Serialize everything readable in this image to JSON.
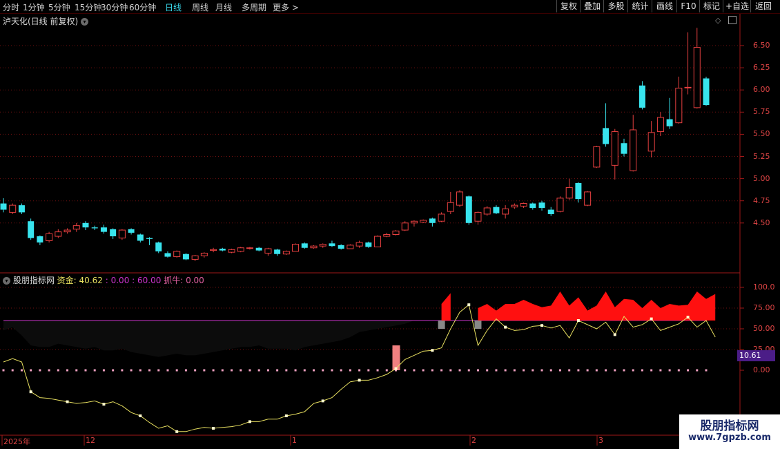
{
  "toolbar": {
    "periods": [
      "分时",
      "1分钟",
      "5分钟",
      "15分钟",
      "30分钟",
      "60分钟",
      "日线",
      "周线",
      "月线",
      "多周期",
      "更多 >"
    ],
    "active_period": "日线",
    "tools": [
      "复权",
      "叠加",
      "多股",
      "统计",
      "画线",
      "F10",
      "标记",
      "+自选",
      "返回"
    ]
  },
  "stock": {
    "title": "泸天化(日线 前复权)"
  },
  "price_axis": {
    "labels": [
      "6.50",
      "6.25",
      "6.00",
      "5.75",
      "5.50",
      "5.25",
      "5.00",
      "4.75",
      "4.50"
    ]
  },
  "indicator": {
    "name": "股朋指标网",
    "fund_label": "资金:",
    "fund_value": "40.62",
    "v2": "0.00",
    "v3": "60.00",
    "grab_label": "抓牛:",
    "grab_value": "0.00",
    "axis_labels": [
      "100.0",
      "75.00",
      "50.00",
      "25.00",
      "0.00"
    ],
    "badge": "10.61"
  },
  "date_axis": {
    "labels": [
      "2025年",
      "12",
      "1",
      "2",
      "3"
    ]
  },
  "watermark": {
    "line1": "股朋指标网",
    "line2": "www.7gpzb.com"
  },
  "colors": {
    "up": "#e84040",
    "down": "#38e4ee",
    "magenta": "#cc33cc",
    "fund": "#e8e060"
  },
  "chart_data": [
    {
      "type": "candlestick",
      "title": "泸天化(日线 前复权)",
      "ylim": [
        4.2,
        6.75
      ],
      "candles": [
        [
          4.72,
          4.65,
          4.78,
          4.62
        ],
        [
          4.62,
          4.7,
          4.72,
          4.6
        ],
        [
          4.7,
          4.62,
          4.72,
          4.6
        ],
        [
          4.52,
          4.33,
          4.55,
          4.31
        ],
        [
          4.35,
          4.28,
          4.36,
          4.25
        ],
        [
          4.3,
          4.38,
          4.4,
          4.28
        ],
        [
          4.35,
          4.4,
          4.43,
          4.33
        ],
        [
          4.4,
          4.42,
          4.44,
          4.38
        ],
        [
          4.43,
          4.47,
          4.5,
          4.4
        ],
        [
          4.5,
          4.45,
          4.52,
          4.42
        ],
        [
          4.45,
          4.44,
          4.47,
          4.42
        ],
        [
          4.45,
          4.4,
          4.48,
          4.38
        ],
        [
          4.43,
          4.35,
          4.44,
          4.32
        ],
        [
          4.33,
          4.42,
          4.43,
          4.31
        ],
        [
          4.43,
          4.39,
          4.44,
          4.37
        ],
        [
          4.37,
          4.3,
          4.38,
          4.28
        ],
        [
          4.33,
          4.32,
          4.34,
          4.25
        ],
        [
          4.28,
          4.18,
          4.29,
          4.16
        ],
        [
          4.16,
          4.12,
          4.18,
          4.11
        ],
        [
          4.12,
          4.18,
          4.19,
          4.11
        ],
        [
          4.15,
          4.09,
          4.16,
          4.08
        ],
        [
          4.09,
          4.13,
          4.14,
          4.07
        ],
        [
          4.13,
          4.16,
          4.17,
          4.11
        ],
        [
          4.19,
          4.2,
          4.22,
          4.17
        ],
        [
          4.21,
          4.19,
          4.22,
          4.18
        ],
        [
          4.17,
          4.2,
          4.21,
          4.16
        ],
        [
          4.18,
          4.22,
          4.23,
          4.17
        ],
        [
          4.22,
          4.22,
          4.23,
          4.2
        ],
        [
          4.22,
          4.19,
          4.23,
          4.18
        ],
        [
          4.16,
          4.21,
          4.22,
          4.13
        ],
        [
          4.2,
          4.15,
          4.21,
          4.13
        ],
        [
          4.15,
          4.18,
          4.19,
          4.14
        ],
        [
          4.18,
          4.26,
          4.27,
          4.18
        ],
        [
          4.27,
          4.22,
          4.28,
          4.21
        ],
        [
          4.22,
          4.24,
          4.25,
          4.21
        ],
        [
          4.24,
          4.26,
          4.27,
          4.22
        ],
        [
          4.27,
          4.24,
          4.3,
          4.23
        ],
        [
          4.25,
          4.21,
          4.26,
          4.2
        ],
        [
          4.21,
          4.25,
          4.26,
          4.21
        ],
        [
          4.24,
          4.28,
          4.3,
          4.22
        ],
        [
          4.28,
          4.23,
          4.29,
          4.22
        ],
        [
          4.23,
          4.35,
          4.36,
          4.23
        ],
        [
          4.35,
          4.37,
          4.39,
          4.34
        ],
        [
          4.37,
          4.41,
          4.42,
          4.36
        ],
        [
          4.42,
          4.5,
          4.52,
          4.41
        ],
        [
          4.5,
          4.52,
          4.53,
          4.46
        ],
        [
          4.51,
          4.53,
          4.54,
          4.5
        ],
        [
          4.55,
          4.5,
          4.56,
          4.46
        ],
        [
          4.52,
          4.6,
          4.62,
          4.51
        ],
        [
          4.63,
          4.73,
          4.85,
          4.6
        ],
        [
          4.7,
          4.85,
          4.87,
          4.68
        ],
        [
          4.8,
          4.5,
          4.81,
          4.48
        ],
        [
          4.52,
          4.62,
          4.63,
          4.48
        ],
        [
          4.6,
          4.67,
          4.69,
          4.58
        ],
        [
          4.68,
          4.61,
          4.7,
          4.6
        ],
        [
          4.6,
          4.66,
          4.7,
          4.55
        ],
        [
          4.68,
          4.7,
          4.72,
          4.66
        ],
        [
          4.69,
          4.72,
          4.73,
          4.67
        ],
        [
          4.72,
          4.67,
          4.73,
          4.65
        ],
        [
          4.73,
          4.67,
          4.75,
          4.64
        ],
        [
          4.65,
          4.6,
          4.68,
          4.58
        ],
        [
          4.63,
          4.78,
          4.8,
          4.62
        ],
        [
          4.78,
          4.9,
          5.0,
          4.76
        ],
        [
          4.95,
          4.77,
          4.96,
          4.73
        ],
        [
          4.7,
          4.85,
          4.86,
          4.69
        ],
        [
          5.13,
          5.36,
          5.37,
          5.12
        ],
        [
          5.57,
          5.39,
          5.85,
          5.36
        ],
        [
          5.15,
          5.53,
          5.56,
          4.99
        ],
        [
          5.4,
          5.28,
          5.45,
          5.25
        ],
        [
          5.09,
          5.55,
          5.72,
          5.08
        ],
        [
          6.05,
          5.8,
          6.1,
          5.78
        ],
        [
          5.31,
          5.52,
          5.65,
          5.24
        ],
        [
          5.53,
          5.69,
          5.75,
          5.48
        ],
        [
          5.67,
          5.59,
          5.91,
          5.56
        ],
        [
          5.63,
          6.02,
          6.15,
          5.62
        ],
        [
          6.03,
          6.03,
          6.65,
          5.95
        ],
        [
          5.8,
          6.48,
          6.7,
          5.79
        ],
        [
          6.13,
          5.83,
          6.15,
          5.82
        ]
      ]
    },
    {
      "type": "line",
      "title": "股朋指标网",
      "ylim": [
        -25,
        112
      ],
      "series": [
        {
          "name": "资金",
          "values": [
            10,
            14,
            10,
            -26,
            -33,
            -34,
            -36,
            -38,
            -40,
            -39,
            -37,
            -41,
            -38,
            -43,
            -51,
            -55,
            -63,
            -70,
            -67,
            -74,
            -74,
            -71,
            -69,
            -70,
            -69,
            -68,
            -66,
            -62,
            -62,
            -59,
            -59,
            -55,
            -53,
            -50,
            -40,
            -37,
            -33,
            -23,
            -14,
            -12,
            -12,
            -9,
            -5,
            2,
            13,
            18,
            23,
            24,
            27,
            50,
            70,
            79,
            30,
            48,
            62,
            52,
            48,
            49,
            53,
            54,
            51,
            54,
            39,
            60,
            55,
            50,
            58,
            43,
            65,
            52,
            55,
            62,
            48,
            52,
            56,
            64,
            52,
            60,
            40
          ]
        },
        {
          "name": "抓牛",
          "values": [
            0,
            0,
            0,
            0,
            0,
            0,
            0,
            0,
            0,
            0,
            0,
            0,
            0,
            0,
            0,
            0,
            0,
            0,
            0,
            0,
            0,
            0,
            0,
            0,
            0,
            0,
            0,
            0,
            0,
            0,
            0,
            0,
            0,
            0,
            0,
            0,
            0,
            0,
            0,
            0,
            0,
            0,
            0,
            0,
            0,
            0,
            0,
            0,
            0,
            0,
            0,
            0,
            0,
            0,
            0,
            0,
            0,
            0,
            0,
            0,
            0,
            0,
            0,
            0,
            0,
            0,
            0,
            0,
            0,
            0,
            0,
            0,
            0,
            0,
            0,
            0,
            0,
            0,
            0
          ]
        }
      ],
      "reference_lines": [
        60,
        0
      ],
      "red_band": [
        80,
        93,
        0,
        0,
        75,
        80,
        72,
        80,
        80,
        85,
        80,
        76,
        78,
        95,
        78,
        88,
        72,
        78,
        95,
        76,
        86,
        85,
        75,
        85,
        75,
        80,
        78,
        79,
        95,
        86,
        92
      ]
    }
  ]
}
